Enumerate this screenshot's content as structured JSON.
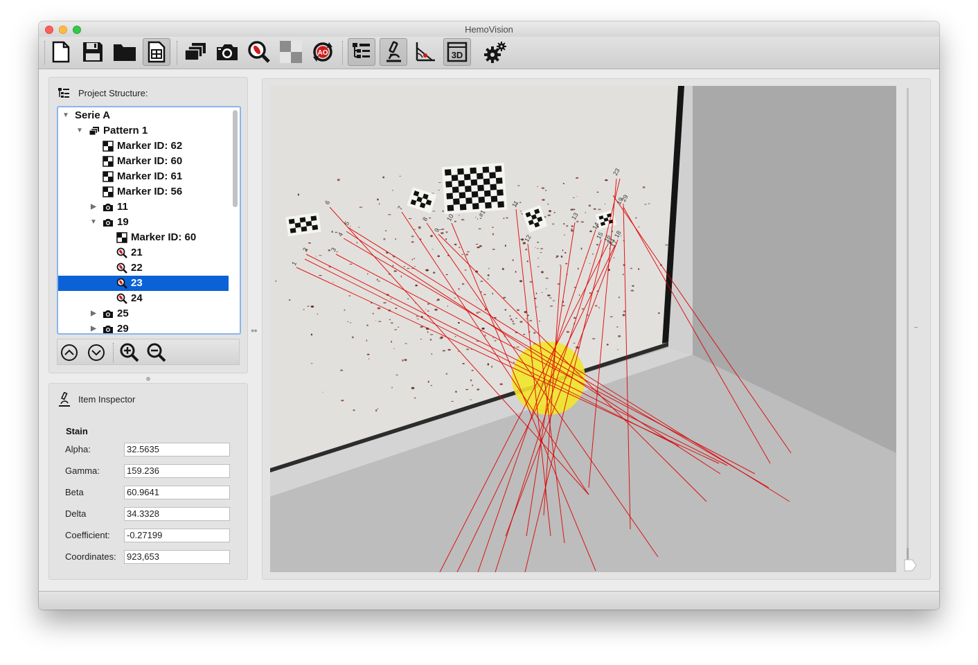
{
  "window": {
    "title": "HemoVision"
  },
  "toolbar": {
    "buttons": [
      {
        "icon": "new-document-icon"
      },
      {
        "icon": "save-icon"
      },
      {
        "icon": "open-folder-icon"
      },
      {
        "icon": "layout-grid-icon",
        "active": true
      },
      {
        "icon": "patterns-stack-icon"
      },
      {
        "icon": "camera-icon"
      },
      {
        "icon": "stain-magnifier-icon"
      },
      {
        "icon": "marker-checker-icon"
      },
      {
        "icon": "area-of-origin-icon"
      },
      {
        "icon": "project-tree-icon",
        "active": true
      },
      {
        "icon": "microscope-icon",
        "active": true
      },
      {
        "icon": "angle-measure-icon"
      },
      {
        "icon": "3d-view-icon",
        "active": true
      },
      {
        "icon": "settings-gears-icon"
      }
    ],
    "ao_text": "AO",
    "view_3d_text": "3D"
  },
  "project": {
    "title": "Project Structure:",
    "tree": [
      {
        "label": "Serie A",
        "depth": 0,
        "icon": "none",
        "expander": "open"
      },
      {
        "label": "Pattern 1",
        "depth": 1,
        "icon": "pattern",
        "expander": "open"
      },
      {
        "label": "Marker ID: 62",
        "depth": 2,
        "icon": "marker",
        "expander": "none"
      },
      {
        "label": "Marker ID: 60",
        "depth": 2,
        "icon": "marker",
        "expander": "none"
      },
      {
        "label": "Marker ID: 61",
        "depth": 2,
        "icon": "marker",
        "expander": "none"
      },
      {
        "label": "Marker ID: 56",
        "depth": 2,
        "icon": "marker",
        "expander": "none"
      },
      {
        "label": "11",
        "depth": 2,
        "icon": "camera",
        "expander": "closed"
      },
      {
        "label": "19",
        "depth": 2,
        "icon": "camera",
        "expander": "open"
      },
      {
        "label": "Marker ID: 60",
        "depth": 3,
        "icon": "marker",
        "expander": "none"
      },
      {
        "label": "21",
        "depth": 3,
        "icon": "stain",
        "expander": "none"
      },
      {
        "label": "22",
        "depth": 3,
        "icon": "stain",
        "expander": "none"
      },
      {
        "label": "23",
        "depth": 3,
        "icon": "stain",
        "expander": "none",
        "selected": true
      },
      {
        "label": "24",
        "depth": 3,
        "icon": "stain",
        "expander": "none"
      },
      {
        "label": "25",
        "depth": 2,
        "icon": "camera",
        "expander": "closed"
      },
      {
        "label": "29",
        "depth": 2,
        "icon": "camera",
        "expander": "closed"
      }
    ]
  },
  "inspector": {
    "title": "Item Inspector",
    "section": "Stain",
    "fields": [
      {
        "label": "Alpha:",
        "value": "32.5635"
      },
      {
        "label": "Gamma:",
        "value": "159.236"
      },
      {
        "label": "Beta",
        "value": "60.9641"
      },
      {
        "label": "Delta",
        "value": "34.3328"
      },
      {
        "label": "Coefficient:",
        "value": "-0.27199"
      },
      {
        "label": "Coordinates:",
        "value": "923,653"
      }
    ]
  },
  "viewport": {
    "mode": "3D",
    "wall_labels": [
      "1",
      "2",
      "3",
      "4",
      "5",
      "6",
      "7",
      "8",
      "9",
      "10",
      "11",
      "12",
      "13",
      "14",
      "15",
      "16",
      "17",
      "18",
      "19",
      "21",
      "23",
      "29",
      "#1"
    ],
    "colors": {
      "trajectory": "#dd0000",
      "origin": "#f2e62a",
      "selection": "#0b62d6"
    }
  }
}
